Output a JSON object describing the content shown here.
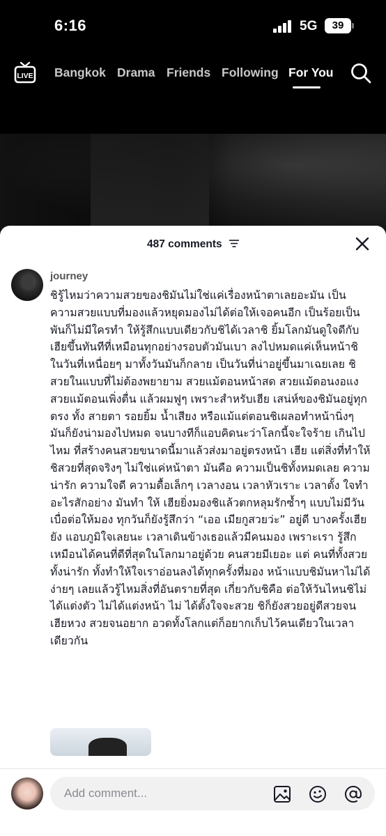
{
  "status": {
    "time": "6:16",
    "network": "5G",
    "battery": "39"
  },
  "nav": {
    "tabs": [
      {
        "label": "Bangkok"
      },
      {
        "label": "Drama"
      },
      {
        "label": "Friends"
      },
      {
        "label": "Following"
      },
      {
        "label": "For You"
      }
    ],
    "active_tab": "For You"
  },
  "comments_sheet": {
    "count_label": "487 comments",
    "comment": {
      "username": "journey",
      "text": "ชิรู้ไหมว่าความสวยของชิมันไม่ใช่แค่เรื่องหน้าตาเลยอะมัน เป็นความสวยแบบที่มองแล้วหยุดมองไม่ได้ต่อให้เจอคนอีก เป็นร้อยเป็นพันก็ไม่มีใครทำ ให้รู้สึกแบบเดียวกับชิได้เวลาชิ ยิ้มโลกมันดูใจดีกับเฮียขึ้นทันทีที่เหมือนทุกอย่างรอบตัวมันเบา ลงไปหมดแค่เห็นหน้าชิในวันที่เหนื่อยๆ มาทั้งวันมันก็กลาย เป็นวันที่น่าอยู่ขึ้นมาเฉยเลย ชิสวยในแบบที่ไม่ต้องพยายาม สวยแม้ตอนหน้าสด สวยแม้ตอนงอแง สวยแม้ตอนเพิ่งตื่น แล้วผมฟูๆ เพราะสำหรับเฮีย เสน่ห์ของชิมันอยู่ทุกตรง ทั้ง สายตา รอยยิ้ม น้ำเสียง หรือแม้แต่ตอนชิเผลอทำหน้านิ่งๆ มันก็ยังน่ามองไปหมด จนบางทีก็แอบคิดนะว่าโลกนี้จะใจร้าย เกินไปไหม ที่สร้างคนสวยขนาดนี้มาแล้วส่งมาอยู่ตรงหน้า เฮีย แต่สิ่งที่ทำให้ชิสวยที่สุดจริงๆ ไม่ใช่แค่หน้าตา มันคือ ความเป็นชิทั้งหมดเลย ความน่ารัก ความใจดี ความดื้อเล็กๆ เวลางอน เวลาหัวเราะ เวลาตั้ง ใจทำอะไรสักอย่าง มันทำ ให้ เฮียยิ่งมองชิแล้วตกหลุมรักซ้ำๆ แบบไม่มีวันเบื่อต่อให้มอง ทุกวันก็ยังรู้สึกว่า “เออ เมียกูสวยว่ะ” อยู่ดี บางครั้งเฮียยัง แอบภูมิใจเลยนะ เวลาเดินข้างเธอแล้วมีคนมอง เพราะเรา รู้สึกเหมือนได้คนที่ดีที่สุดในโลกมาอยู่ด้วย คนสวยมีเยอะ แต่ คนที่ทั้งสวย ทั้งน่ารัก ทั้งทำให้ใจเราอ่อนลงได้ทุกครั้งที่มอง หน้าแบบชิมันหาไม่ได้ง่ายๆ เลยแล้วรู้ไหมสิ่งที่อันตรายที่สุด เกี่ยวกับชิคือ ต่อให้วันไหนชิไม่ได้แต่งตัว ไม่ได้แต่งหน้า ไม่ ได้ตั้งใจจะสวย ชิก็ยังสวยอยู่ดีสวยจนเฮียหวง สวยจนอยาก อวดทั้งโลกแต่ก็อยากเก็บไว้คนเดียวในเวลาเดียวกัน"
    }
  },
  "input_bar": {
    "placeholder": "Add comment..."
  },
  "icons": {
    "live": "live-icon",
    "search": "search-icon",
    "filter": "filter-icon",
    "close": "close-icon",
    "image": "image-icon",
    "emoji": "emoji-icon",
    "mention": "at-icon"
  },
  "colors": {
    "sheet_bg": "#ffffff",
    "text_primary": "#161823",
    "text_secondary": "#8a8b91",
    "nav_bg": "#000000"
  }
}
